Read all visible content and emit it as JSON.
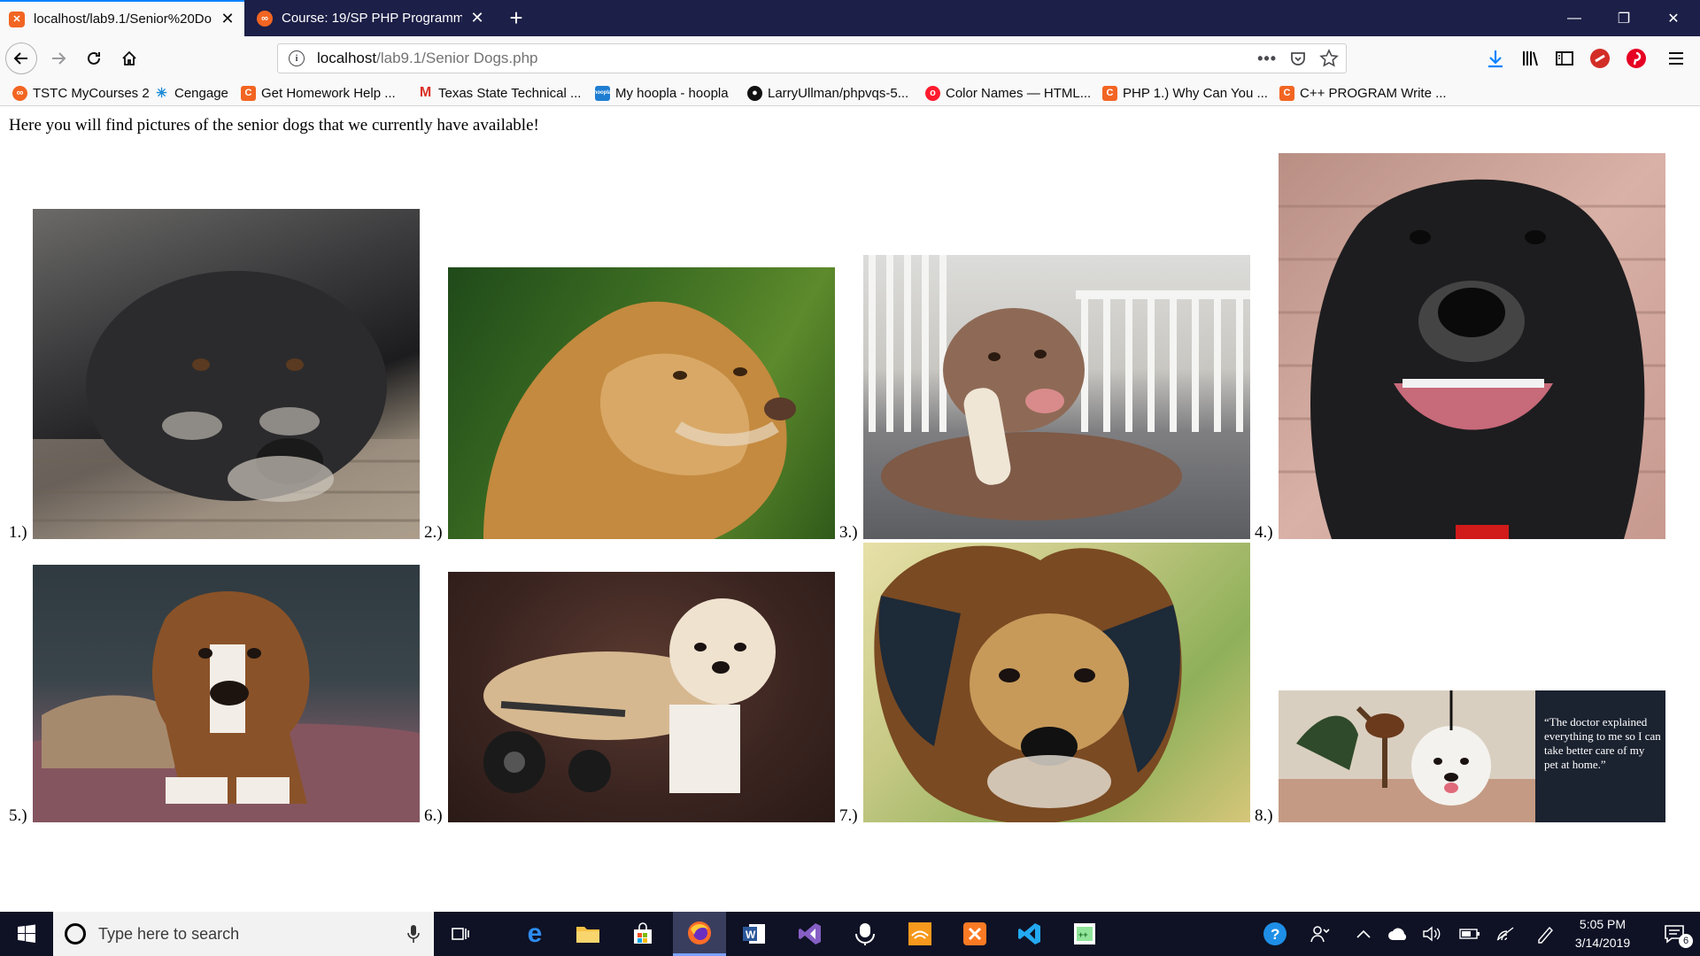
{
  "browser": {
    "tabs": [
      {
        "title": "localhost/lab9.1/Senior%20Do",
        "active": true
      },
      {
        "title": "Course: 19/SP PHP Programmin",
        "active": false
      }
    ],
    "address": {
      "host": "localhost",
      "path": "/lab9.1/Senior Dogs.php"
    },
    "toolbar_icons": [
      "download-icon",
      "library-icon",
      "sidebar-icon",
      "lastpass-icon",
      "pinterest-icon",
      "menu-icon"
    ]
  },
  "bookmarks": [
    {
      "label": "TSTC MyCourses 2",
      "icon": "tstc-icon"
    },
    {
      "label": "Cengage",
      "icon": "cengage-icon"
    },
    {
      "label": "Get Homework Help ...",
      "icon": "chegg-icon"
    },
    {
      "label": "Texas State Technical ...",
      "icon": "gmail-icon"
    },
    {
      "label": "My hoopla - hoopla",
      "icon": "hoopla-icon"
    },
    {
      "label": "LarryUllman/phpvqs-5...",
      "icon": "github-icon"
    },
    {
      "label": "Color Names — HTML...",
      "icon": "opera-icon"
    },
    {
      "label": "PHP 1.) Why Can You ...",
      "icon": "chegg-icon"
    },
    {
      "label": "C++ PROGRAM Write ...",
      "icon": "chegg-icon"
    }
  ],
  "page": {
    "intro": "Here you will find pictures of the senior dogs that we currently have available!",
    "dogs": [
      {
        "label": "1.)",
        "photo": "black senior dog resting head on wooden deck"
      },
      {
        "label": "2.)",
        "photo": "senior golden retriever in green grass"
      },
      {
        "label": "3.)",
        "photo": "brown senior dog chewing bone on porch"
      },
      {
        "label": "4.)",
        "photo": "grey-muzzled black labrador smiling"
      },
      {
        "label": "5.)",
        "photo": "senior boxer lying on a bed"
      },
      {
        "label": "6.)",
        "photo": "small white dog in a wheelchair cart"
      },
      {
        "label": "7.)",
        "photo": "senior beagle mix close-up"
      },
      {
        "label": "8.)",
        "photo": "white dog with testimonial quote",
        "quote": "“The doctor explained everything to me so I can take better care of my pet at home.”"
      }
    ]
  },
  "taskbar": {
    "search_placeholder": "Type here to search",
    "time": "5:05 PM",
    "date": "3/14/2019",
    "notification_count": "6",
    "apps": [
      "task-view-icon",
      "edge-icon",
      "file-explorer-icon",
      "store-icon",
      "firefox-icon",
      "word-icon",
      "visual-studio-icon",
      "teams-icon",
      "audible-icon",
      "xampp-icon",
      "vscode-icon",
      "notepadpp-icon"
    ]
  },
  "colors": {
    "tab_strip": "#1c1f47",
    "accent": "#0a84ff",
    "taskbar": "#0f1225"
  }
}
